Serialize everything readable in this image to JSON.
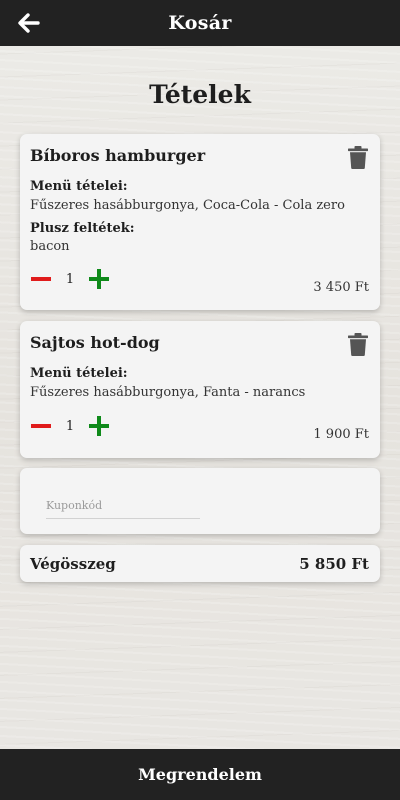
{
  "header": {
    "title": "Kosár",
    "back_icon": "arrow-left-icon"
  },
  "section_title": "Tételek",
  "items": [
    {
      "name": "Bíboros hamburger",
      "menu_label": "Menü tételei:",
      "menu_value": "Fűszeres hasábburgonya, Coca-Cola - Cola zero",
      "extras_label": "Plusz feltétek:",
      "extras_value": "bacon",
      "quantity": "1",
      "price": "3 450 Ft"
    },
    {
      "name": "Sajtos hot-dog",
      "menu_label": "Menü tételei:",
      "menu_value": "Fűszeres hasábburgonya, Fanta - narancs",
      "quantity": "1",
      "price": "1 900 Ft"
    }
  ],
  "coupon": {
    "placeholder": "Kuponkód",
    "value": ""
  },
  "total": {
    "label": "Végösszeg",
    "value": "5 850 Ft"
  },
  "order_button": {
    "label": "Megrendelem"
  },
  "colors": {
    "bar": "#222222",
    "minus": "#e01b1b",
    "plus": "#0f8a1a",
    "trash": "#555555",
    "card": "#f4f4f4"
  }
}
